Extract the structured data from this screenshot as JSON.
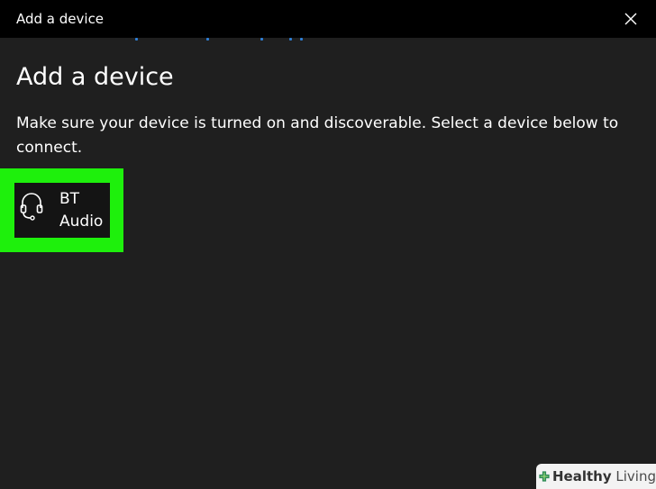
{
  "window": {
    "title": "Add a device",
    "close_icon": "close-icon"
  },
  "main": {
    "heading": "Add a device",
    "description": "Make sure your device is turned on and discoverable. Select a device below to connect."
  },
  "devices": [
    {
      "name": "BT Audio",
      "icon": "headset-icon"
    }
  ],
  "highlight_color": "#1ef00c",
  "accent_color": "#2f7fd6",
  "watermark": {
    "brand_bold": "Healthy",
    "brand_regular": " Living",
    "logo": "plus-cross-logo"
  }
}
